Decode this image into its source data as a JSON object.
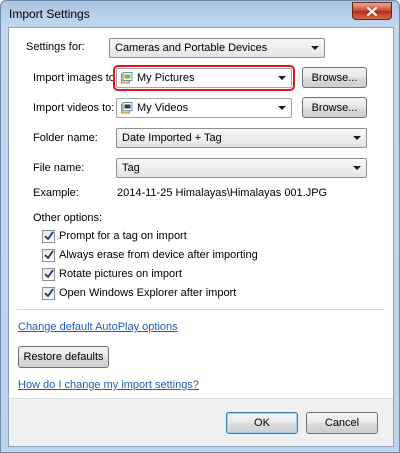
{
  "window": {
    "title": "Import Settings",
    "close_icon": "close-icon"
  },
  "settings_for": {
    "label": "Settings for:",
    "value": "Cameras and Portable Devices"
  },
  "import_images": {
    "label": "Import images to:",
    "value": "My Pictures",
    "browse": "Browse...",
    "highlight_color": "#e2141d"
  },
  "import_videos": {
    "label": "Import videos to:",
    "value": "My Videos",
    "browse": "Browse..."
  },
  "folder_name": {
    "label": "Folder name:",
    "value": "Date Imported + Tag"
  },
  "file_name": {
    "label": "File name:",
    "value": "Tag"
  },
  "example": {
    "label": "Example:",
    "value": "2014-11-25 Himalayas\\Himalayas 001.JPG"
  },
  "other_options": {
    "label": "Other options:",
    "items": [
      {
        "label": "Prompt for a tag on import",
        "checked": true
      },
      {
        "label": "Always erase from device after importing",
        "checked": true
      },
      {
        "label": "Rotate pictures on import",
        "checked": true
      },
      {
        "label": "Open Windows Explorer after import",
        "checked": true
      }
    ]
  },
  "links": {
    "autoplay": "Change default AutoPlay options",
    "help": "How do I change my import settings?"
  },
  "buttons": {
    "restore": "Restore defaults",
    "ok": "OK",
    "cancel": "Cancel"
  },
  "colors": {
    "link": "#1f5cb8",
    "title_bar": "#bcd3ec",
    "close_button": "#c7452f"
  }
}
